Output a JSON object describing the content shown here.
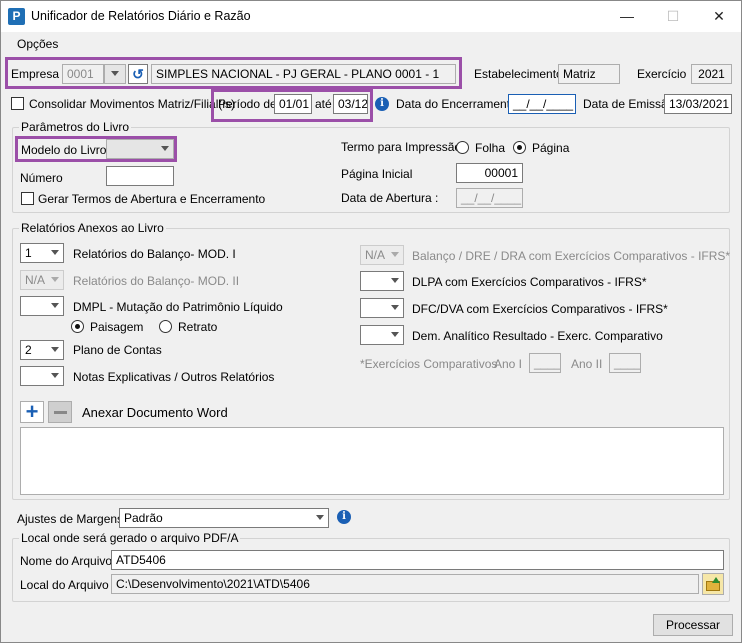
{
  "window": {
    "title": "Unificador de Relatórios Diário e Razão",
    "minimize": "—",
    "maximize": "☐",
    "close": "✕"
  },
  "menu": {
    "opcoes": "Opções"
  },
  "empresa": {
    "label": "Empresa",
    "code": "0001",
    "name": "SIMPLES NACIONAL - PJ GERAL - PLANO 0001 - 1"
  },
  "estabelecimento": {
    "label": "Estabelecimento",
    "value": "Matriz"
  },
  "exercicio": {
    "label": "Exercício",
    "value": "2021"
  },
  "consolidar": {
    "label": "Consolidar Movimentos Matriz/Filial(is)"
  },
  "periodo": {
    "label": "Período de",
    "from": "01/01",
    "ate": "até",
    "to": "03/12"
  },
  "encerramento": {
    "label": "Data do Encerramento",
    "value": "__/__/____"
  },
  "emissao": {
    "label": "Data de Emissão",
    "value": "13/03/2021"
  },
  "parametros": {
    "title": "Parâmetros do Livro",
    "modelo_label": "Modelo do Livro",
    "numero_label": "Número",
    "gerar_termos": "Gerar Termos de Abertura e Encerramento",
    "termo_label": "Termo para Impressão",
    "folha": "Folha",
    "pagina": "Página",
    "pagina_inicial_label": "Página Inicial",
    "pagina_inicial_value": "00001",
    "data_abertura_label": "Data de Abertura :",
    "data_abertura_value": "__/__/____"
  },
  "anexos": {
    "title": "Relatórios Anexos ao Livro",
    "balanco_val": "1",
    "balanco_label": "Relatórios do Balanço- MOD. I",
    "balanco2_val": "N/A",
    "balanco2_label": "Relatórios do Balanço- MOD. II",
    "dmpl_label": "DMPL - Mutação do Patrimônio Líquido",
    "paisagem": "Paisagem",
    "retrato": "Retrato",
    "plano_val": "2",
    "plano_label": "Plano de Contas",
    "notas_label": "Notas Explicativas / Outros Relatórios",
    "ifrs_val": "N/A",
    "ifrs_label": "Balanço / DRE / DRA com Exercícios Comparativos - IFRS*",
    "dlpa_label": "DLPA com Exercícios Comparativos - IFRS*",
    "dfc_label": "DFC/DVA com Exercícios Comparativos - IFRS*",
    "dem_label": "Dem. Analítico Resultado - Exerc. Comparativo",
    "comparativos_label": "*Exercícios Comparativos",
    "ano1_label": "Ano I",
    "ano1_value": "____",
    "ano2_label": "Ano II",
    "ano2_value": "____",
    "anexar_label": "Anexar Documento Word"
  },
  "margens": {
    "label": "Ajustes de Margens",
    "value": "Padrão"
  },
  "local": {
    "title": "Local onde será gerado o arquivo PDF/A",
    "nome_label": "Nome do Arquivo",
    "nome_value": "ATD5406",
    "local_label": "Local do Arquivo",
    "local_value": "C:\\Desenvolvimento\\2021\\ATD\\5406"
  },
  "processar": "Processar"
}
